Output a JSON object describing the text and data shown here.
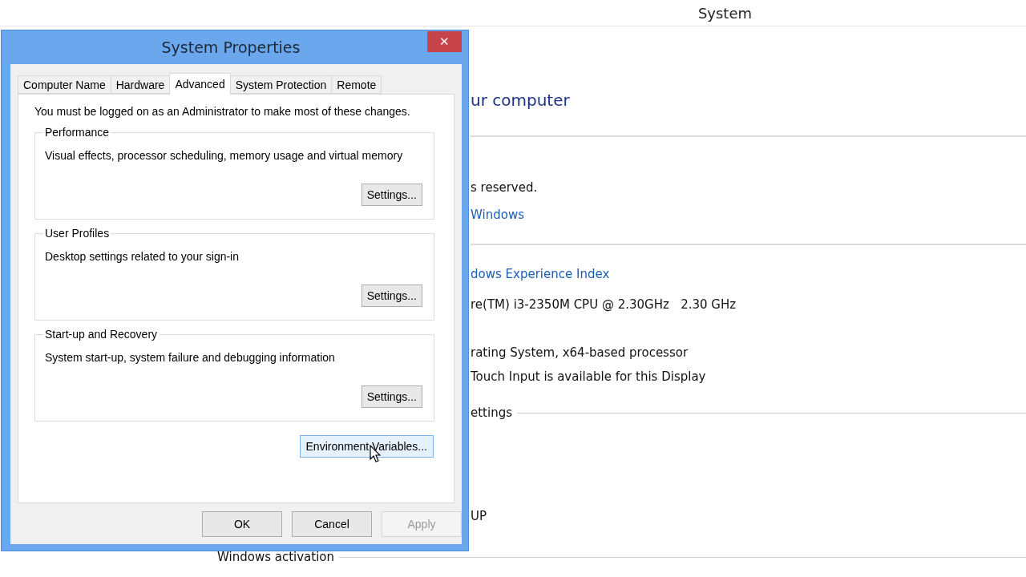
{
  "background_window": {
    "title": "System",
    "lines": [
      {
        "kind": "heading",
        "text": "ur computer"
      },
      {
        "kind": "divider"
      },
      {
        "kind": "text",
        "text": "s reserved."
      },
      {
        "kind": "link",
        "text": "Windows"
      },
      {
        "kind": "divider"
      },
      {
        "kind": "link",
        "text": "dows Experience Index"
      },
      {
        "kind": "text",
        "text": "re(TM) i3-2350M CPU @ 2.30GHz   2.30 GHz"
      },
      {
        "kind": "text",
        "text": "rating System, x64-based processor"
      },
      {
        "kind": "text",
        "text": "Touch Input is available for this Display"
      },
      {
        "kind": "section",
        "text": "ettings"
      },
      {
        "kind": "text",
        "text": "UP"
      }
    ],
    "activation_section": "Windows activation"
  },
  "dialog": {
    "title": "System Properties",
    "close": "✕",
    "tabs": [
      {
        "label": "Computer Name",
        "selected": false
      },
      {
        "label": "Hardware",
        "selected": false
      },
      {
        "label": "Advanced",
        "selected": true
      },
      {
        "label": "System Protection",
        "selected": false
      },
      {
        "label": "Remote",
        "selected": false
      }
    ],
    "notice": "You must be logged on as an Administrator to make most of these changes.",
    "groups": [
      {
        "title": "Performance",
        "description": "Visual effects, processor scheduling, memory usage and virtual memory",
        "button": "Settings..."
      },
      {
        "title": "User Profiles",
        "description": "Desktop settings related to your sign-in",
        "button": "Settings..."
      },
      {
        "title": "Start-up and Recovery",
        "description": "System start-up, system failure and debugging information",
        "button": "Settings..."
      }
    ],
    "env_button": {
      "label": "Environment Variables...",
      "hovered": true
    },
    "buttons": [
      {
        "label": "OK",
        "disabled": false
      },
      {
        "label": "Cancel",
        "disabled": false
      },
      {
        "label": "Apply",
        "disabled": true
      }
    ]
  }
}
